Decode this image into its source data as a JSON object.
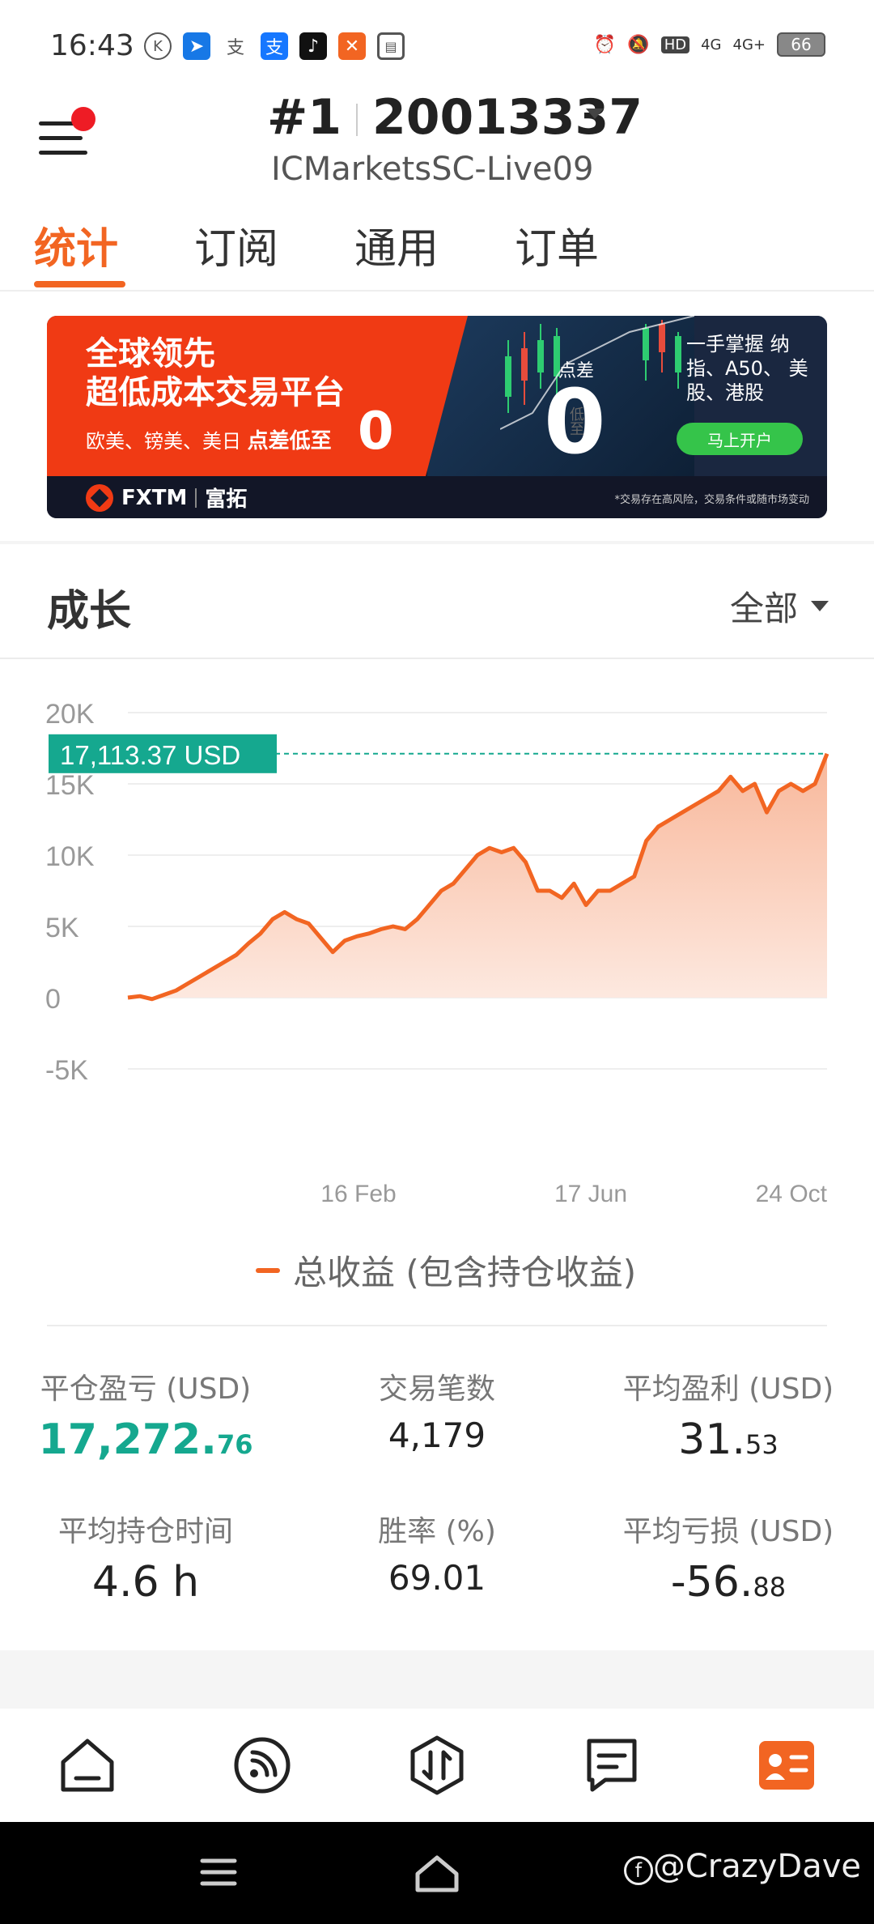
{
  "status_bar": {
    "time": "16:43",
    "network": [
      "HD",
      "4G",
      "4G+"
    ],
    "battery": "66"
  },
  "header": {
    "account_rank": "#1",
    "account_number": "20013337",
    "server": "ICMarketsSC-Live09"
  },
  "tabs": [
    {
      "label": "统计",
      "active": true
    },
    {
      "label": "订阅",
      "active": false
    },
    {
      "label": "通用",
      "active": false
    },
    {
      "label": "订单",
      "active": false
    }
  ],
  "banner": {
    "headline1": "全球领先",
    "headline2": "超低成本交易平台",
    "sub": "欧美、镑美、美日",
    "sub_bold": "点差低至",
    "zero": "0",
    "diancha": "点差",
    "di_zhi": "低至",
    "right_text": "一手掌握 纳指、A50、 美股、港股",
    "cta": "马上开户",
    "brand": "FXTM",
    "brand_cn": "富拓",
    "disclaimer": "*交易存在高风险，交易条件或随市场变动"
  },
  "growth": {
    "title": "成长",
    "filter": "全部",
    "current_value_label": "17,113.37 USD",
    "legend": "总收益 (包含持仓收益)"
  },
  "chart_data": {
    "type": "area",
    "y_ticks": [
      "20K",
      "15K",
      "10K",
      "5K",
      "0",
      "-5K"
    ],
    "ylim": [
      -5000,
      20000
    ],
    "x_ticks": [
      "16 Feb",
      "17 Jun",
      "24 Oct"
    ],
    "highlight": 17113.37,
    "series": [
      {
        "values": [
          0,
          100,
          -100,
          200,
          500,
          1000,
          1500,
          2000,
          2500,
          3000,
          3800,
          4500,
          5500,
          6000,
          5500,
          5200,
          4200,
          3200,
          4000,
          4300,
          4500,
          4800,
          5000,
          4800,
          5500,
          6500,
          7500,
          8000,
          9000,
          10000,
          10500,
          10200,
          10500,
          9500,
          7500,
          7500,
          7000,
          8000,
          6500,
          7500,
          7500,
          8000,
          8500,
          11000,
          12000,
          12500,
          13000,
          13500,
          14000,
          14500,
          15500,
          14500,
          15000,
          13000,
          14500,
          15000,
          14500,
          15000,
          17113.37
        ]
      }
    ],
    "colors": {
      "line": "#f26522",
      "fill_top": "#f8b79a",
      "fill_bottom": "#fde9e0",
      "highlight": "#15a88f"
    }
  },
  "stats": [
    {
      "label": "平仓盈亏 (USD)",
      "int": "17,272.",
      "dec": "76",
      "style": "green"
    },
    {
      "label": "交易笔数",
      "int": "4,179",
      "dec": "",
      "style": "small"
    },
    {
      "label": "平均盈利 (USD)",
      "int": "31.",
      "dec": "53",
      "style": "normal"
    },
    {
      "label": "平均持仓时间",
      "int": "4.6 h",
      "dec": "",
      "style": "normal"
    },
    {
      "label": "胜率 (%)",
      "int": "69.01",
      "dec": "",
      "style": "small"
    },
    {
      "label": "平均亏损 (USD)",
      "int": "-56.",
      "dec": "88",
      "style": "normal"
    }
  ],
  "bottom_nav": [
    {
      "icon": "home-icon"
    },
    {
      "icon": "signal-feed-icon"
    },
    {
      "icon": "trade-swap-icon"
    },
    {
      "icon": "message-icon"
    },
    {
      "icon": "profile-card-icon",
      "active": true
    }
  ],
  "watermark": "@CrazyDave"
}
